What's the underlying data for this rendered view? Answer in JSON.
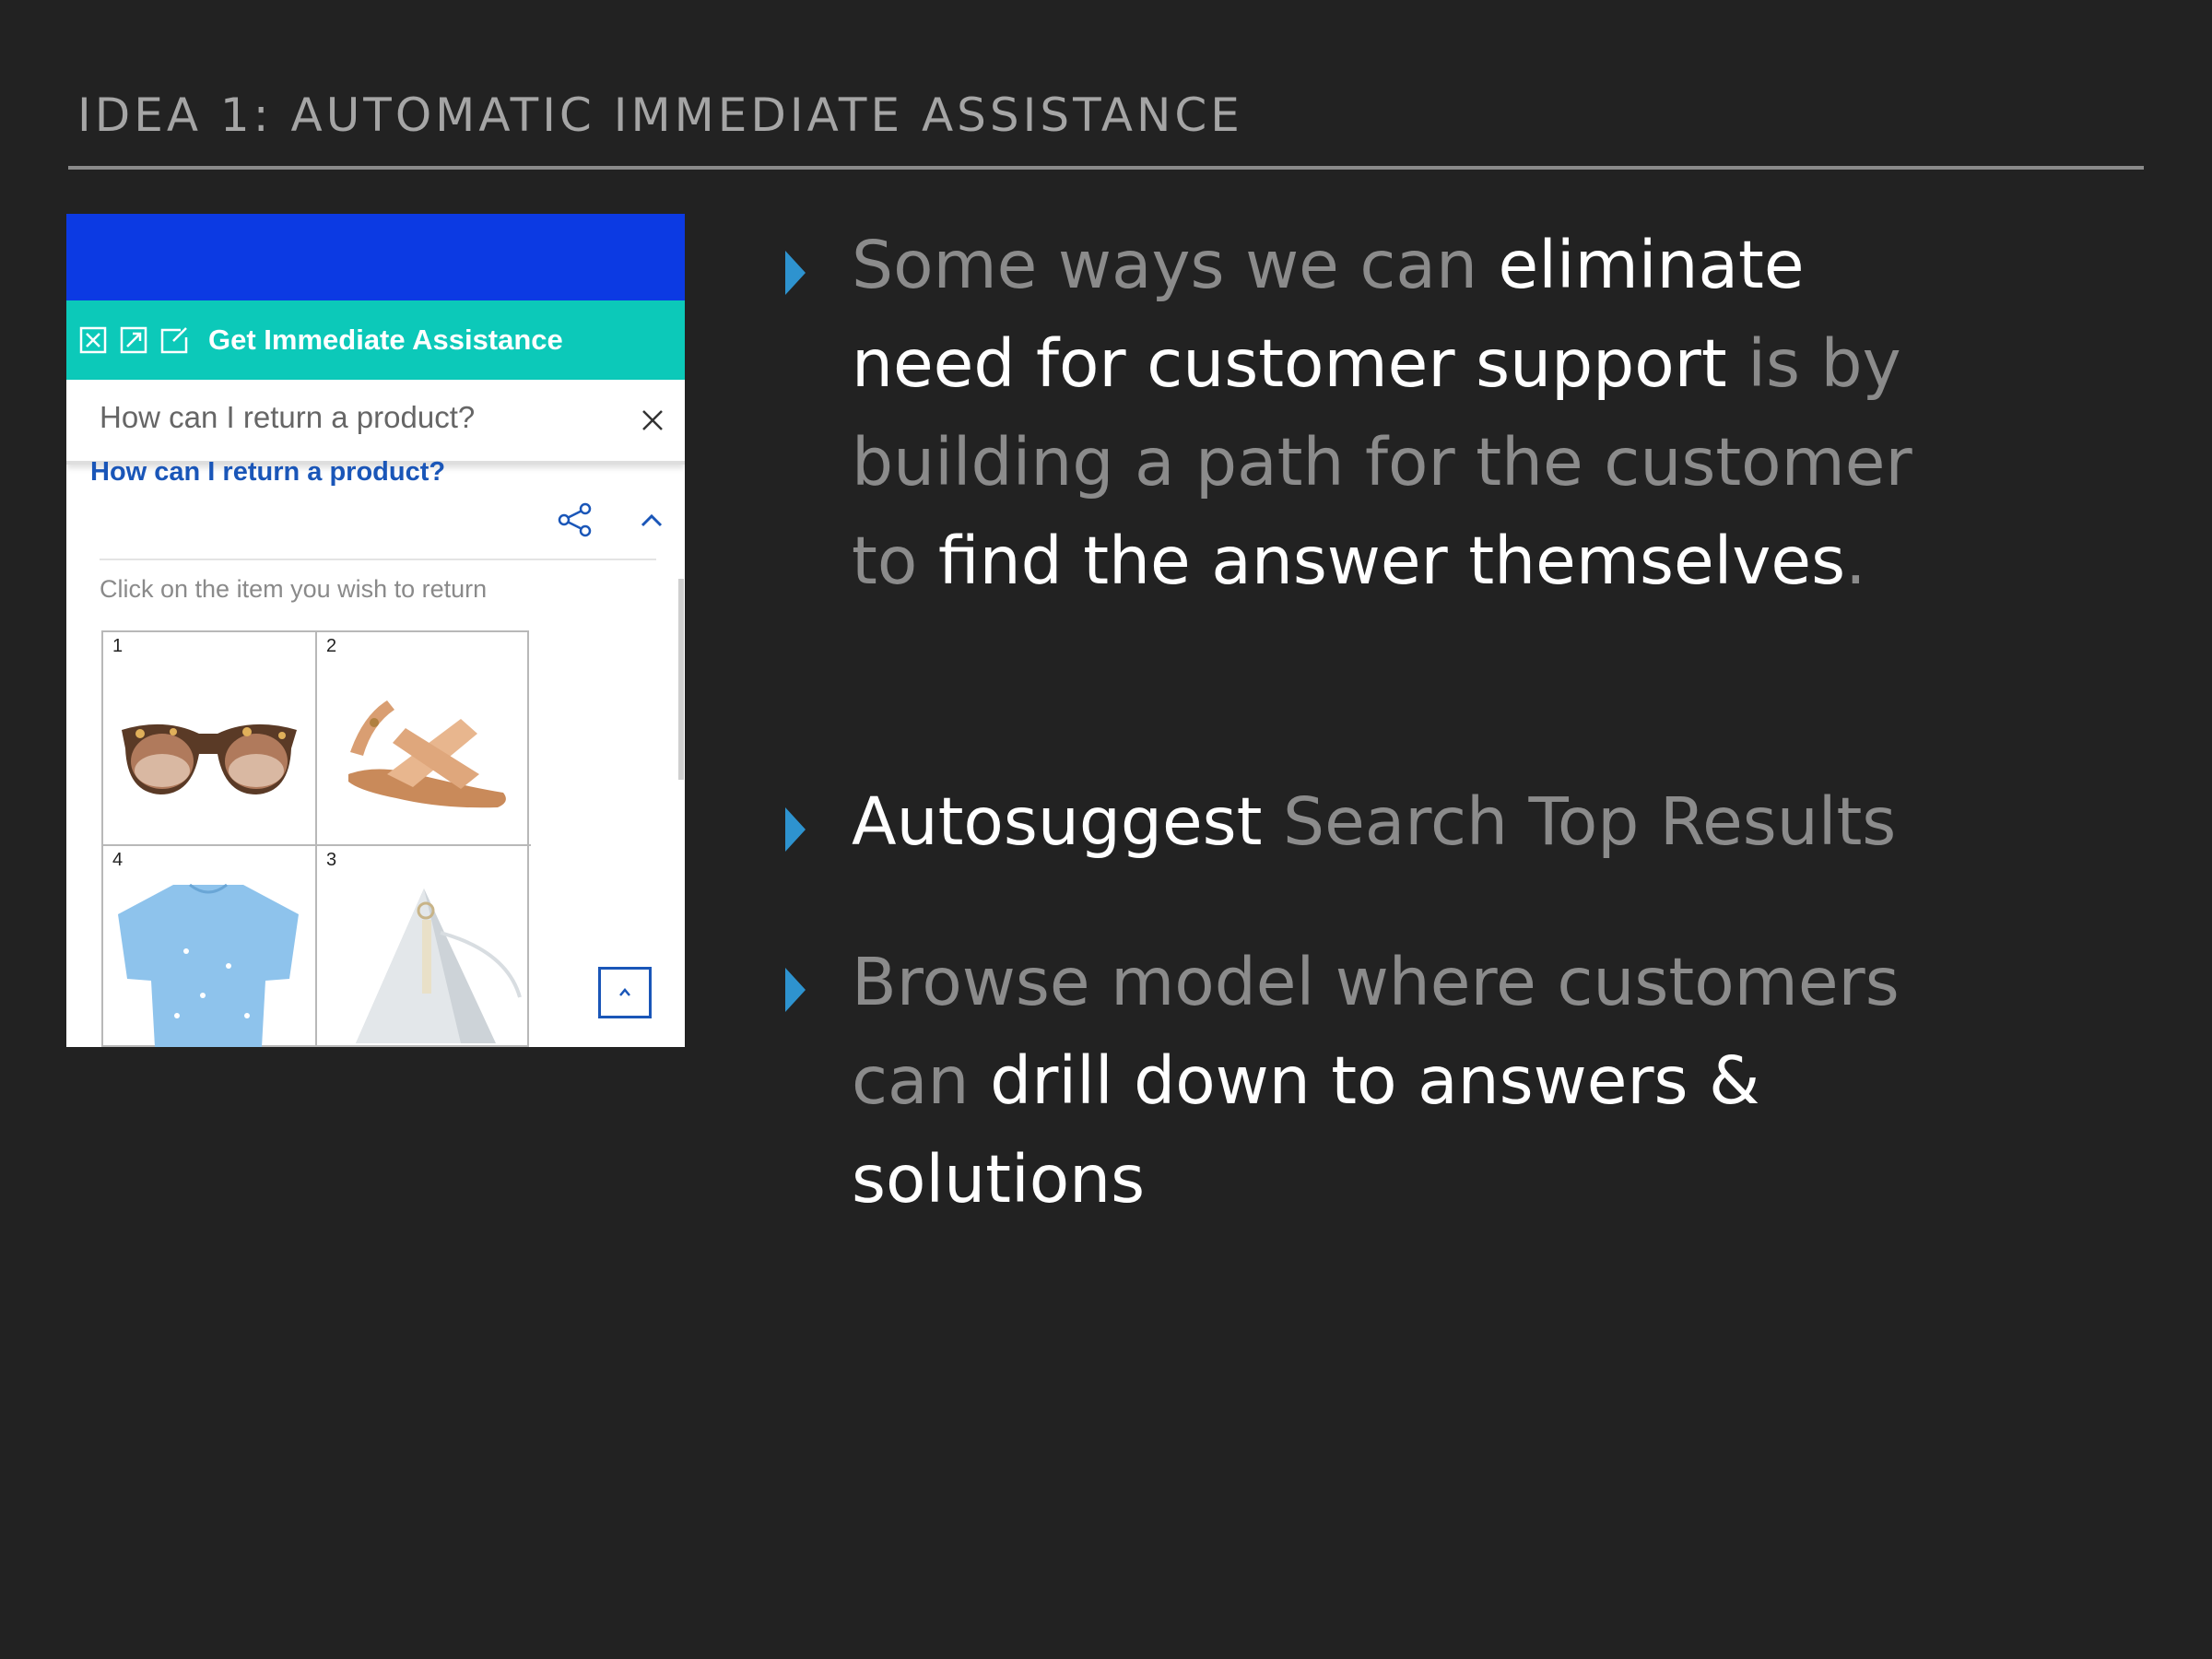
{
  "slide": {
    "title": "IDEA 1: AUTOMATIC IMMEDIATE ASSISTANCE"
  },
  "widget": {
    "header_title": "Get Immediate Assistance",
    "header_icons": [
      "close-box-icon",
      "expand-icon",
      "edit-icon"
    ],
    "search_value": "How can I return a product?",
    "question_title": "How can I return a product?",
    "instruction": "Click on the item you wish to return",
    "items": [
      {
        "number": "1",
        "product": "sunglasses"
      },
      {
        "number": "2",
        "product": "sandal"
      },
      {
        "number": "4",
        "product": "blue top"
      },
      {
        "number": "3",
        "product": "silver bag"
      }
    ],
    "colors": {
      "topbar": "#0c3ae3",
      "header": "#0cc9b9",
      "link": "#1a56b8"
    }
  },
  "bullets": [
    {
      "segments": [
        {
          "text": "Some ways we can ",
          "style": "dim"
        },
        {
          "text": "eliminate need for customer support",
          "style": "hl"
        },
        {
          "text": " is by building a path for the customer to ",
          "style": "dim"
        },
        {
          "text": "find the answer themselves",
          "style": "hl"
        },
        {
          "text": ".",
          "style": "dim"
        }
      ]
    },
    {
      "segments": [
        {
          "text": "Autosuggest",
          "style": "hl"
        },
        {
          "text": " Search Top Results",
          "style": "dim"
        }
      ]
    },
    {
      "segments": [
        {
          "text": "Browse model where customers can ",
          "style": "dim"
        },
        {
          "text": "drill down to answers & solutions",
          "style": "hl"
        }
      ]
    }
  ],
  "colors": {
    "background": "#222222",
    "bullet_marker": "#2e93cf",
    "highlight_text": "#ffffff",
    "dim_text": "#8b8b8b"
  }
}
